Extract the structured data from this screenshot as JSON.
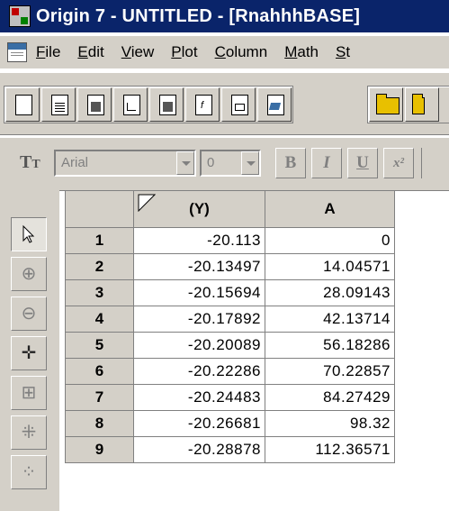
{
  "window": {
    "title": "Origin 7 - UNTITLED - [RnahhhBASE]"
  },
  "menu": [
    "File",
    "Edit",
    "View",
    "Plot",
    "Column",
    "Math",
    "St"
  ],
  "toolbar": {
    "buttons": [
      "new-project-icon",
      "new-worksheet-icon",
      "new-excel-icon",
      "new-graph-icon",
      "new-matrix-icon",
      "new-function-icon",
      "new-layout-icon",
      "new-note-icon",
      "open-icon",
      "open-template-icon"
    ]
  },
  "format_bar": {
    "font_name": "Arial",
    "font_size": "0",
    "bold_label": "B",
    "italic_label": "I",
    "underline_label": "U",
    "superscript_label": "x²"
  },
  "tools": [
    "pointer-icon",
    "zoom-in-icon",
    "zoom-out-icon",
    "screen-reader-icon",
    "data-selector-icon",
    "data-reader-icon",
    "mask-icon"
  ],
  "worksheet": {
    "columns": [
      "(Y)",
      "A"
    ],
    "rows": [
      {
        "num": "1",
        "y": "-20.113",
        "a": "0"
      },
      {
        "num": "2",
        "y": "-20.13497",
        "a": "14.04571"
      },
      {
        "num": "3",
        "y": "-20.15694",
        "a": "28.09143"
      },
      {
        "num": "4",
        "y": "-20.17892",
        "a": "42.13714"
      },
      {
        "num": "5",
        "y": "-20.20089",
        "a": "56.18286"
      },
      {
        "num": "6",
        "y": "-20.22286",
        "a": "70.22857"
      },
      {
        "num": "7",
        "y": "-20.24483",
        "a": "84.27429"
      },
      {
        "num": "8",
        "y": "-20.26681",
        "a": "98.32"
      },
      {
        "num": "9",
        "y": "-20.28878",
        "a": "112.36571"
      }
    ]
  }
}
